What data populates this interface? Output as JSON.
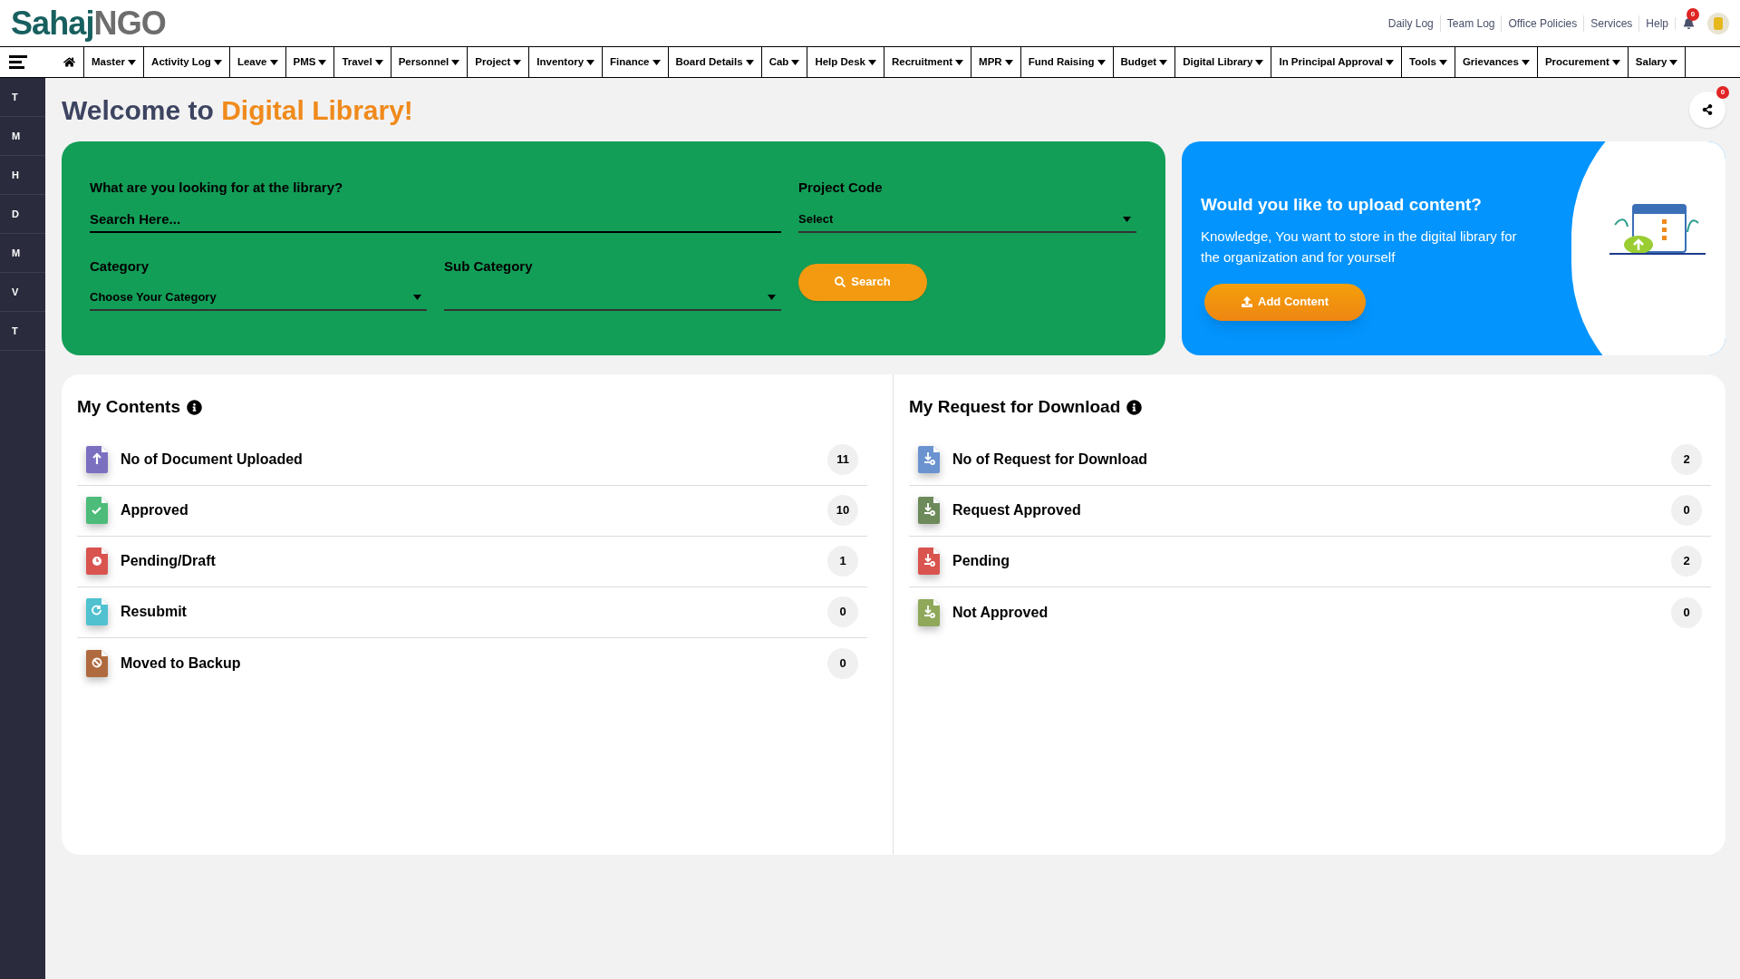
{
  "header": {
    "logo_part1": "Sahaj",
    "logo_part2": "NGO",
    "links": [
      "Daily Log",
      "Team Log",
      "Office Policies",
      "Services",
      "Help"
    ],
    "notification_count": "0"
  },
  "nav": [
    {
      "label": "Master"
    },
    {
      "label": "Activity Log"
    },
    {
      "label": "Leave"
    },
    {
      "label": "PMS"
    },
    {
      "label": "Travel"
    },
    {
      "label": "Personnel"
    },
    {
      "label": "Project"
    },
    {
      "label": "Inventory"
    },
    {
      "label": "Finance"
    },
    {
      "label": "Board Details"
    },
    {
      "label": "Cab"
    },
    {
      "label": "Help Desk"
    },
    {
      "label": "Recruitment"
    },
    {
      "label": "MPR"
    },
    {
      "label": "Fund Raising"
    },
    {
      "label": "Budget"
    },
    {
      "label": "Digital Library"
    },
    {
      "label": "In Principal Approval"
    },
    {
      "label": "Tools"
    },
    {
      "label": "Grievances"
    },
    {
      "label": "Procurement"
    },
    {
      "label": "Salary"
    }
  ],
  "sidebar": {
    "items": [
      "T",
      "M",
      "H",
      "D",
      "M",
      "V",
      "T"
    ]
  },
  "page": {
    "title_prefix": "Welcome to",
    "title_highlight": "Digital Library!",
    "share_count": "0"
  },
  "search_card": {
    "query_label": "What are you looking for at the library?",
    "query_placeholder": "Search Here...",
    "project_label": "Project Code",
    "project_value": "Select",
    "category_label": "Category",
    "category_value": "Choose Your Category",
    "subcategory_label": "Sub Category",
    "search_button": "Search"
  },
  "upload_card": {
    "title": "Would you like to upload content?",
    "text": "Knowledge, You want to store in the digital library for the organization and for yourself",
    "button": "Add Content"
  },
  "panels": [
    {
      "title": "My Contents",
      "rows": [
        {
          "label": "No of Document Uploaded",
          "count": "11",
          "color": "#7b6fc0"
        },
        {
          "label": "Approved",
          "count": "10",
          "color": "#4dbb7a"
        },
        {
          "label": "Pending/Draft",
          "count": "1",
          "color": "#d9534f"
        },
        {
          "label": "Resubmit",
          "count": "0",
          "color": "#4fc1cf"
        },
        {
          "label": "Moved to Backup",
          "count": "0",
          "color": "#b06a3f"
        }
      ]
    },
    {
      "title": "My Request for Download",
      "rows": [
        {
          "label": "No of Request for Download",
          "count": "2",
          "color": "#6a93cf"
        },
        {
          "label": "Request Approved",
          "count": "0",
          "color": "#6c8a5a"
        },
        {
          "label": "Pending",
          "count": "2",
          "color": "#d9534f"
        },
        {
          "label": "Not Approved",
          "count": "0",
          "color": "#8fa85a"
        }
      ]
    }
  ]
}
